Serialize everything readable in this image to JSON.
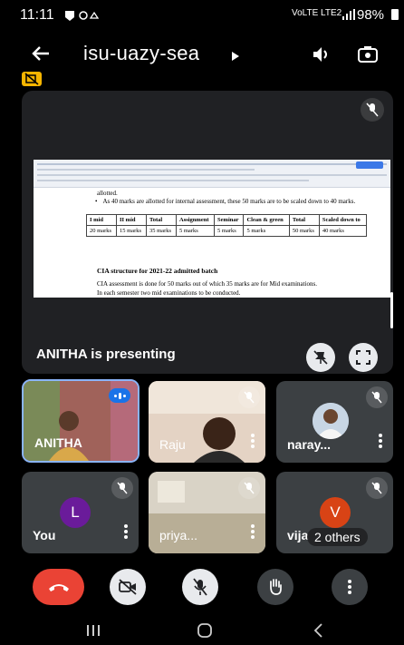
{
  "status": {
    "time": "11:11",
    "lte": "VoLTE LTE2",
    "battery": "98%"
  },
  "meeting": {
    "code": "isu-uazy-sea",
    "presenting": "ANITHA is presenting"
  },
  "doc": {
    "line1": "allotted.",
    "bullet": "As 40 marks are allotted for internal assessment, these 50 marks are to be scaled down to 40 marks.",
    "table_head": [
      "I mid",
      "II mid",
      "Total",
      "Assignment",
      "Seminar",
      "Clean & green",
      "Total",
      "Scaled down to"
    ],
    "table_row": [
      "20 marks",
      "15 marks",
      "35 marks",
      "5 marks",
      "5 marks",
      "5 marks",
      "50 marks",
      "40 marks"
    ],
    "heading": "CIA structure for 2021-22 admitted batch",
    "para1": "CIA assessment is done for 50 marks out of which 35 marks are for Mid examinations.",
    "para2": "In each semester two mid examinations to be conducted."
  },
  "tiles": [
    {
      "name": "ANITHA"
    },
    {
      "name": "Raju"
    },
    {
      "name": "naray..."
    },
    {
      "name": "You",
      "initial": "L",
      "color": "#6a1b9a"
    },
    {
      "name": "priya..."
    },
    {
      "name": "vija",
      "initial": "V",
      "color": "#d84315",
      "others": "2 others"
    }
  ],
  "colors": {
    "end_call": "#ea4335",
    "tile_bg": "#3c4043",
    "active_border": "#8ab4f8"
  }
}
